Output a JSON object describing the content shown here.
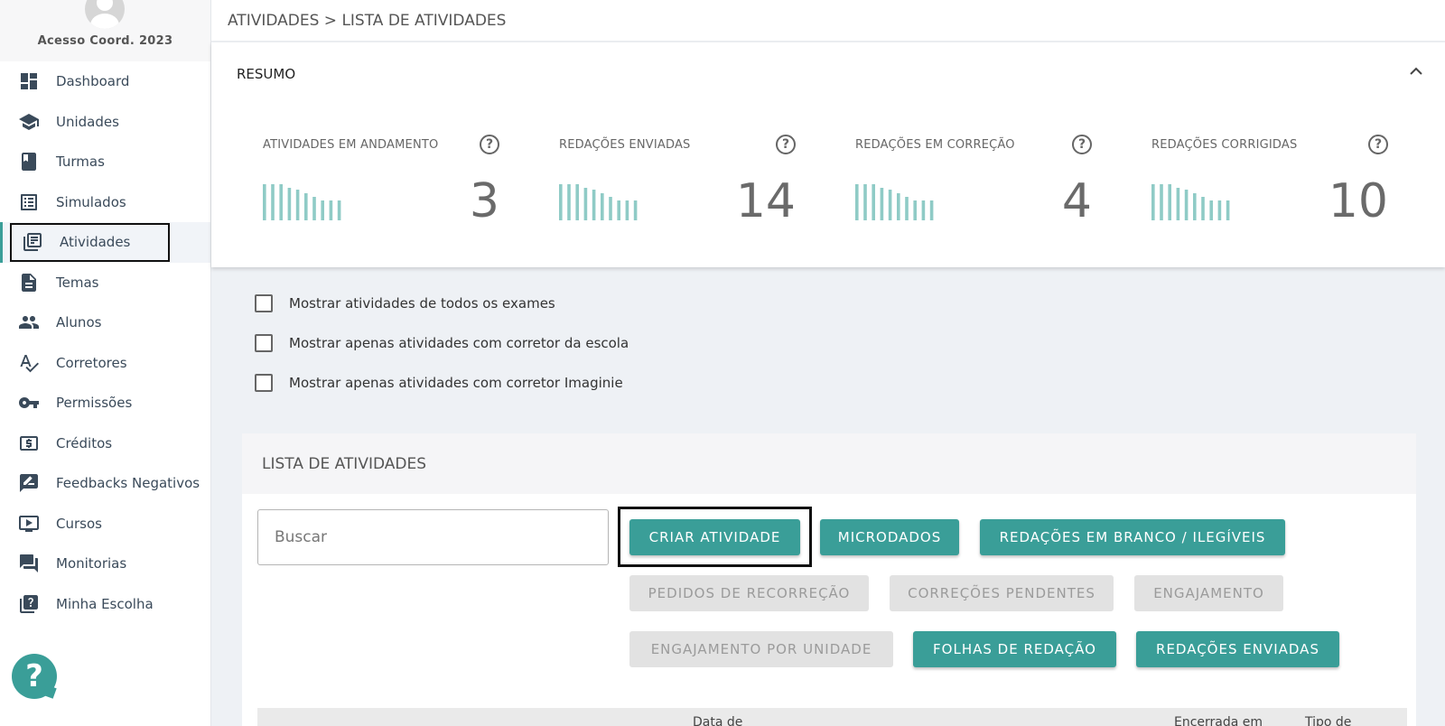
{
  "profile": {
    "name": "Acesso Coord. 2023"
  },
  "sidebar": {
    "items": [
      {
        "label": "Dashboard"
      },
      {
        "label": "Unidades"
      },
      {
        "label": "Turmas"
      },
      {
        "label": "Simulados"
      },
      {
        "label": "Atividades"
      },
      {
        "label": "Temas"
      },
      {
        "label": "Alunos"
      },
      {
        "label": "Corretores"
      },
      {
        "label": "Permissões"
      },
      {
        "label": "Créditos"
      },
      {
        "label": "Feedbacks Negativos"
      },
      {
        "label": "Cursos"
      },
      {
        "label": "Monitorias"
      },
      {
        "label": "Minha Escolha"
      }
    ],
    "active_item": "Atividades"
  },
  "help": {
    "glyph": "?"
  },
  "breadcrumb": "ATIVIDADES > LISTA DE ATIVIDADES",
  "resumo": {
    "title": "RESUMO",
    "stats": [
      {
        "label": "ATIVIDADES EM ANDAMENTO",
        "value": "3"
      },
      {
        "label": "REDAÇÕES ENVIADAS",
        "value": "14"
      },
      {
        "label": "REDAÇÕES EM CORREÇÃO",
        "value": "4"
      },
      {
        "label": "REDAÇÕES CORRIGIDAS",
        "value": "10"
      }
    ],
    "help_glyph": "?"
  },
  "filters": [
    {
      "label": "Mostrar atividades de todos os exames",
      "checked": false
    },
    {
      "label": "Mostrar apenas atividades com corretor da escola",
      "checked": false
    },
    {
      "label": "Mostrar apenas atividades com corretor Imaginie",
      "checked": false
    }
  ],
  "list": {
    "title": "LISTA DE ATIVIDADES",
    "search_placeholder": "Buscar",
    "buttons": {
      "criar": "CRIAR ATIVIDADE",
      "microdados": "MICRODADOS",
      "branco": "REDAÇÕES EM BRANCO / ILEGÍVEIS",
      "recorrecao": "PEDIDOS DE RECORREÇÃO",
      "pendentes": "CORREÇÕES PENDENTES",
      "engajamento": "ENGAJAMENTO",
      "engajamento_unidade": "ENGAJAMENTO POR UNIDADE",
      "folhas": "FOLHAS DE REDAÇÃO",
      "enviadas": "REDAÇÕES ENVIADAS"
    },
    "table_headers": [
      "Data de",
      "Encerrada em",
      "Tipo de"
    ]
  },
  "colors": {
    "accent": "#3a9e98",
    "disabled": "#e2e2e2",
    "bars": "#8fcbc6"
  }
}
